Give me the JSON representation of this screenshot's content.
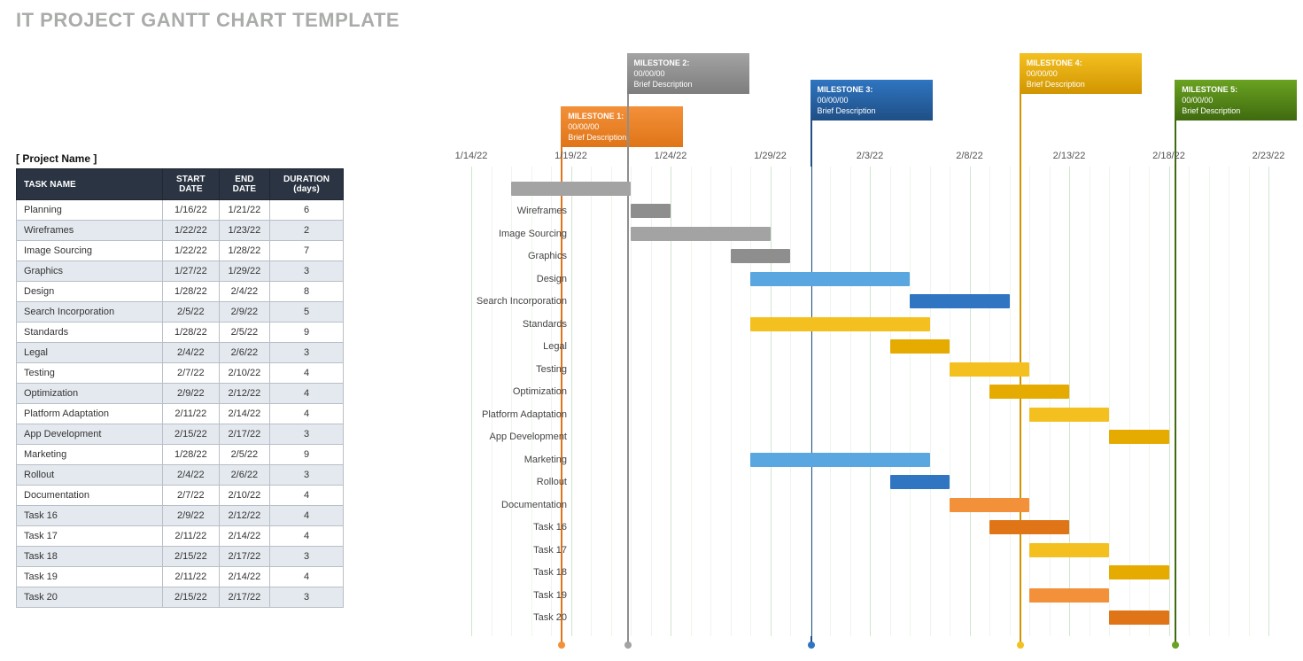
{
  "title": "IT PROJECT GANTT CHART TEMPLATE",
  "project_label": "[ Project Name ]",
  "table_headers": {
    "task": "TASK NAME",
    "start": "START DATE",
    "end": "END DATE",
    "dur": "DURATION (days)"
  },
  "milestones": [
    {
      "label": "MILESTONE 1:",
      "date": "00/00/00",
      "desc": "Brief Description",
      "colorClass": "orange",
      "xDay": 4.5,
      "flagTop": 70
    },
    {
      "label": "MILESTONE 2:",
      "date": "00/00/00",
      "desc": "Brief Description",
      "colorClass": "gray",
      "xDay": 7.8,
      "flagTop": 10
    },
    {
      "label": "MILESTONE 3:",
      "date": "00/00/00",
      "desc": "Brief Description",
      "colorClass": "blue",
      "xDay": 17,
      "flagTop": 40
    },
    {
      "label": "MILESTONE 4:",
      "date": "00/00/00",
      "desc": "Brief Description",
      "colorClass": "gold",
      "xDay": 27.5,
      "flagTop": 10
    },
    {
      "label": "MILESTONE 5:",
      "date": "00/00/00",
      "desc": "Brief Description",
      "colorClass": "green",
      "xDay": 35.3,
      "flagTop": 40
    }
  ],
  "chart_data": {
    "type": "gantt",
    "xlabel": "",
    "ylabel": "",
    "x_start": "1/14/22",
    "x_ticks": [
      "1/14/22",
      "1/19/22",
      "1/24/22",
      "1/29/22",
      "2/3/22",
      "2/8/22",
      "2/13/22",
      "2/18/22",
      "2/23/22"
    ],
    "x_range_days": 40,
    "tasks": [
      {
        "name": "Planning",
        "start": "1/16/22",
        "end": "1/21/22",
        "duration": 6,
        "startDay": 2,
        "color": "gray"
      },
      {
        "name": "Wireframes",
        "start": "1/22/22",
        "end": "1/23/22",
        "duration": 2,
        "startDay": 8,
        "color": "gray-d"
      },
      {
        "name": "Image Sourcing",
        "start": "1/22/22",
        "end": "1/28/22",
        "duration": 7,
        "startDay": 8,
        "color": "gray"
      },
      {
        "name": "Graphics",
        "start": "1/27/22",
        "end": "1/29/22",
        "duration": 3,
        "startDay": 13,
        "color": "gray-d"
      },
      {
        "name": "Design",
        "start": "1/28/22",
        "end": "2/4/22",
        "duration": 8,
        "startDay": 14,
        "color": "blue-l"
      },
      {
        "name": "Search Incorporation",
        "start": "2/5/22",
        "end": "2/9/22",
        "duration": 5,
        "startDay": 22,
        "color": "blue"
      },
      {
        "name": "Standards",
        "start": "1/28/22",
        "end": "2/5/22",
        "duration": 9,
        "startDay": 14,
        "color": "gold"
      },
      {
        "name": "Legal",
        "start": "2/4/22",
        "end": "2/6/22",
        "duration": 3,
        "startDay": 21,
        "color": "gold-d"
      },
      {
        "name": "Testing",
        "start": "2/7/22",
        "end": "2/10/22",
        "duration": 4,
        "startDay": 24,
        "color": "gold"
      },
      {
        "name": "Optimization",
        "start": "2/9/22",
        "end": "2/12/22",
        "duration": 4,
        "startDay": 26,
        "color": "gold-d"
      },
      {
        "name": "Platform Adaptation",
        "start": "2/11/22",
        "end": "2/14/22",
        "duration": 4,
        "startDay": 28,
        "color": "gold"
      },
      {
        "name": "App Development",
        "start": "2/15/22",
        "end": "2/17/22",
        "duration": 3,
        "startDay": 32,
        "color": "gold-d"
      },
      {
        "name": "Marketing",
        "start": "1/28/22",
        "end": "2/5/22",
        "duration": 9,
        "startDay": 14,
        "color": "blue-l"
      },
      {
        "name": "Rollout",
        "start": "2/4/22",
        "end": "2/6/22",
        "duration": 3,
        "startDay": 21,
        "color": "blue"
      },
      {
        "name": "Documentation",
        "start": "2/7/22",
        "end": "2/10/22",
        "duration": 4,
        "startDay": 24,
        "color": "orange"
      },
      {
        "name": "Task 16",
        "start": "2/9/22",
        "end": "2/12/22",
        "duration": 4,
        "startDay": 26,
        "color": "orange-d"
      },
      {
        "name": "Task 17",
        "start": "2/11/22",
        "end": "2/14/22",
        "duration": 4,
        "startDay": 28,
        "color": "gold"
      },
      {
        "name": "Task 18",
        "start": "2/15/22",
        "end": "2/17/22",
        "duration": 3,
        "startDay": 32,
        "color": "gold-d"
      },
      {
        "name": "Task 19",
        "start": "2/11/22",
        "end": "2/14/22",
        "duration": 4,
        "startDay": 28,
        "color": "orange"
      },
      {
        "name": "Task 20",
        "start": "2/15/22",
        "end": "2/17/22",
        "duration": 3,
        "startDay": 32,
        "color": "orange-d"
      }
    ]
  }
}
